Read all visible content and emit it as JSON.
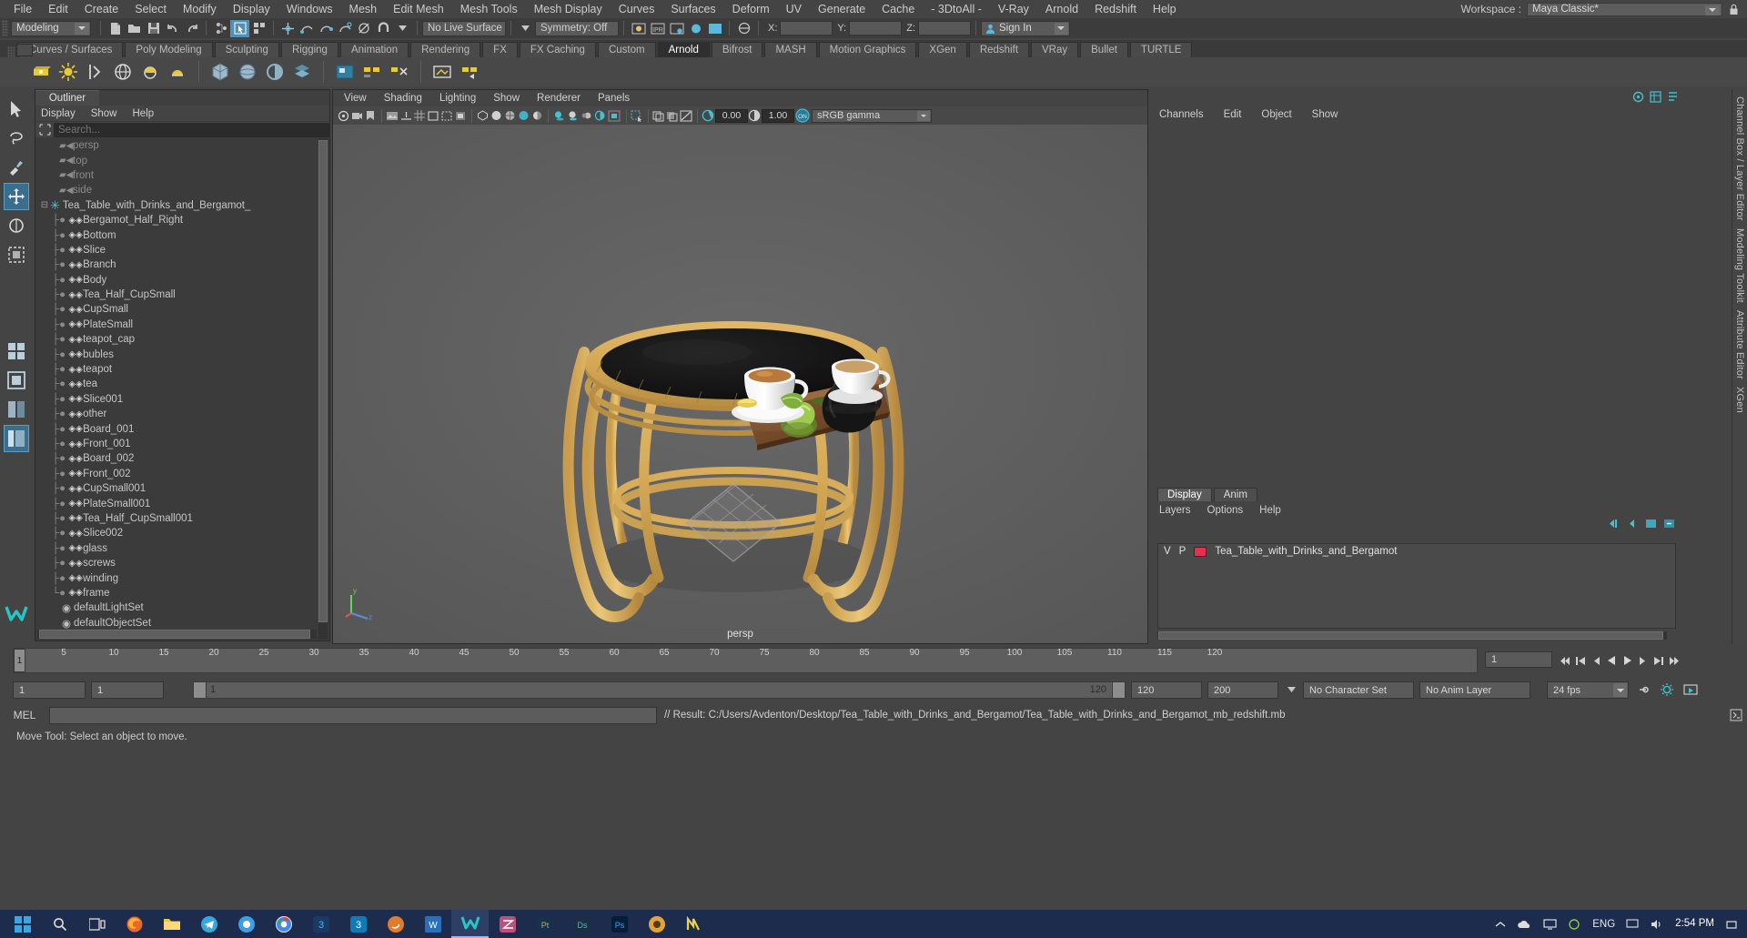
{
  "menubar": {
    "items": [
      "File",
      "Edit",
      "Create",
      "Select",
      "Modify",
      "Display",
      "Windows",
      "Mesh",
      "Edit Mesh",
      "Mesh Tools",
      "Mesh Display",
      "Curves",
      "Surfaces",
      "Deform",
      "UV",
      "Generate",
      "Cache",
      "- 3DtoAll -",
      "V-Ray",
      "Arnold",
      "Redshift",
      "Help"
    ],
    "workspace_label": "Workspace :",
    "workspace_value": "Maya Classic*"
  },
  "statusline": {
    "mode": "Modeling",
    "live_surface": "No Live Surface",
    "symmetry": "Symmetry: Off",
    "axis_x": "X:",
    "axis_y": "Y:",
    "axis_z": "Z:",
    "axis_x_value": "",
    "axis_y_value": "",
    "axis_z_value": "",
    "signin": "Sign In"
  },
  "shelf": {
    "tabs": [
      "Curves / Surfaces",
      "Poly Modeling",
      "Sculpting",
      "Rigging",
      "Animation",
      "Rendering",
      "FX",
      "FX Caching",
      "Custom",
      "Arnold",
      "Bifrost",
      "MASH",
      "Motion Graphics",
      "XGen",
      "Redshift",
      "VRay",
      "Bullet",
      "TURTLE"
    ],
    "active_tab": "Arnold"
  },
  "outliner": {
    "tab": "Outliner",
    "menu": [
      "Display",
      "Show",
      "Help"
    ],
    "search_placeholder": "Search...",
    "cameras": [
      "persp",
      "top",
      "front",
      "side"
    ],
    "root": "Tea_Table_with_Drinks_and_Bergamot_",
    "children": [
      "Bergamot_Half_Right",
      "Bottom",
      "Slice",
      "Branch",
      "Body",
      "Tea_Half_CupSmall",
      "CupSmall",
      "PlateSmall",
      "teapot_cap",
      "bubles",
      "teapot",
      "tea",
      "Slice001",
      "other",
      "Board_001",
      "Front_001",
      "Board_002",
      "Front_002",
      "CupSmall001",
      "PlateSmall001",
      "Tea_Half_CupSmall001",
      "Slice002",
      "glass",
      "screws",
      "winding",
      "frame"
    ],
    "sets": [
      "defaultLightSet",
      "defaultObjectSet"
    ]
  },
  "viewport": {
    "menu": [
      "View",
      "Shading",
      "Lighting",
      "Show",
      "Renderer",
      "Panels"
    ],
    "exposure_value": "0.00",
    "gamma_value": "1.00",
    "color_management": "sRGB gamma",
    "camera_label": "persp"
  },
  "channelbox": {
    "menu": [
      "Channels",
      "Edit",
      "Object",
      "Show"
    ],
    "rail_label": "Channel Box / Layer Editor",
    "rail_items": [
      "Channel Box / Layer Editor",
      "Modeling Toolkit",
      "Attribute Editor",
      "XGen"
    ]
  },
  "layers": {
    "tabs": [
      "Display",
      "Anim"
    ],
    "active_tab": "Display",
    "menu": [
      "Layers",
      "Options",
      "Help"
    ],
    "columns": {
      "v": "V",
      "p": "P"
    },
    "rows": [
      {
        "v": "V",
        "p": "P",
        "color": "#e8304e",
        "name": "Tea_Table_with_Drinks_and_Bergamot"
      }
    ]
  },
  "timeslider": {
    "ticks": [
      5,
      10,
      15,
      20,
      25,
      30,
      35,
      40,
      45,
      50,
      55,
      60,
      65,
      70,
      75,
      80,
      85,
      90,
      95,
      100,
      105,
      110,
      115,
      120
    ],
    "start": 1,
    "end": 120,
    "current_frame": "1",
    "current_frame_field": "1"
  },
  "rangeslider": {
    "anim_start": "1",
    "range_start": "1",
    "playback_start_marker": "1",
    "playback_end_marker": "120",
    "range_end": "120",
    "anim_end": "200",
    "character_set": "No Character Set",
    "anim_layer": "No Anim Layer",
    "fps": "24 fps"
  },
  "commandline": {
    "label": "MEL",
    "input_value": "",
    "result": "// Result: C:/Users/Avdenton/Desktop/Tea_Table_with_Drinks_and_Bergamot/Tea_Table_with_Drinks_and_Bergamot_mb_redshift.mb"
  },
  "helpline": {
    "text": "Move Tool: Select an object to move."
  },
  "taskbar": {
    "language": "ENG",
    "time": "2:54 PM",
    "date": ""
  },
  "colors": {
    "accent_teal": "#3fd0d0",
    "highlight_blue": "#4f92b8",
    "layer_swatch": "#e8304e",
    "panel_bg": "#444444",
    "viewport_bg": "#5e5e5e"
  }
}
